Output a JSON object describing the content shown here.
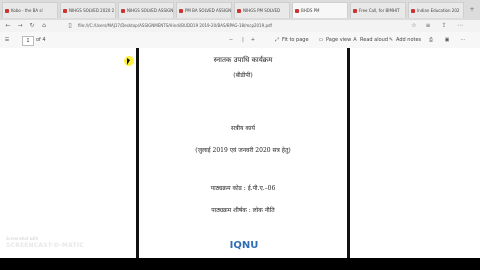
{
  "browser": {
    "tabs": [
      {
        "label": "Kobo - the BA sl"
      },
      {
        "label": "NIHGS SOLVED 2020 2"
      },
      {
        "label": "NIHGS SOLVED ASSIGN"
      },
      {
        "label": "PM BA SOLVED ASSIGN"
      },
      {
        "label": "NIHGS PM SOLVED"
      },
      {
        "label": "BHDS PM"
      },
      {
        "label": "Free Call, for BIMHIT"
      },
      {
        "label": "Indian Education 202"
      }
    ],
    "url": "file:///C:/Users/MAJ17/Desktop/ASSIGNMENTS/Hindi/BUDD19 2019-20/BAS/BPAG-18/mcp2019.pdf"
  },
  "pdf_toolbar": {
    "page_current": "1",
    "page_total": "of 4",
    "fit_label": "Fit to page",
    "page_view_label": "Page view",
    "read_aloud_label": "Read aloud",
    "add_notes_label": "Add notes"
  },
  "document": {
    "line1": "स्नातक उपाधि कार्यक्रम",
    "line2": "(बीडीपी)",
    "line3": "सत्रीय कार्य",
    "line4": "(जुलाई 2019 एवं जनवरी 2020 सत्र हेतु)",
    "line5": "पाठ्यक्रम कोड : ई.पी.ए.–06",
    "line6": "पाठ्यक्रम शीर्षक : लोक नीति",
    "logo_text": "IQNU"
  },
  "watermark": {
    "small": "Screenshot with",
    "big": "SCREENCAST-O-MATIC"
  },
  "colors": {
    "tabbar_bg": "#dcdcdc",
    "viewer_bg": "#ffffff",
    "page_border": "#111111",
    "logo": "#2f6db5",
    "cursor_highlight": "#ffeb00"
  }
}
